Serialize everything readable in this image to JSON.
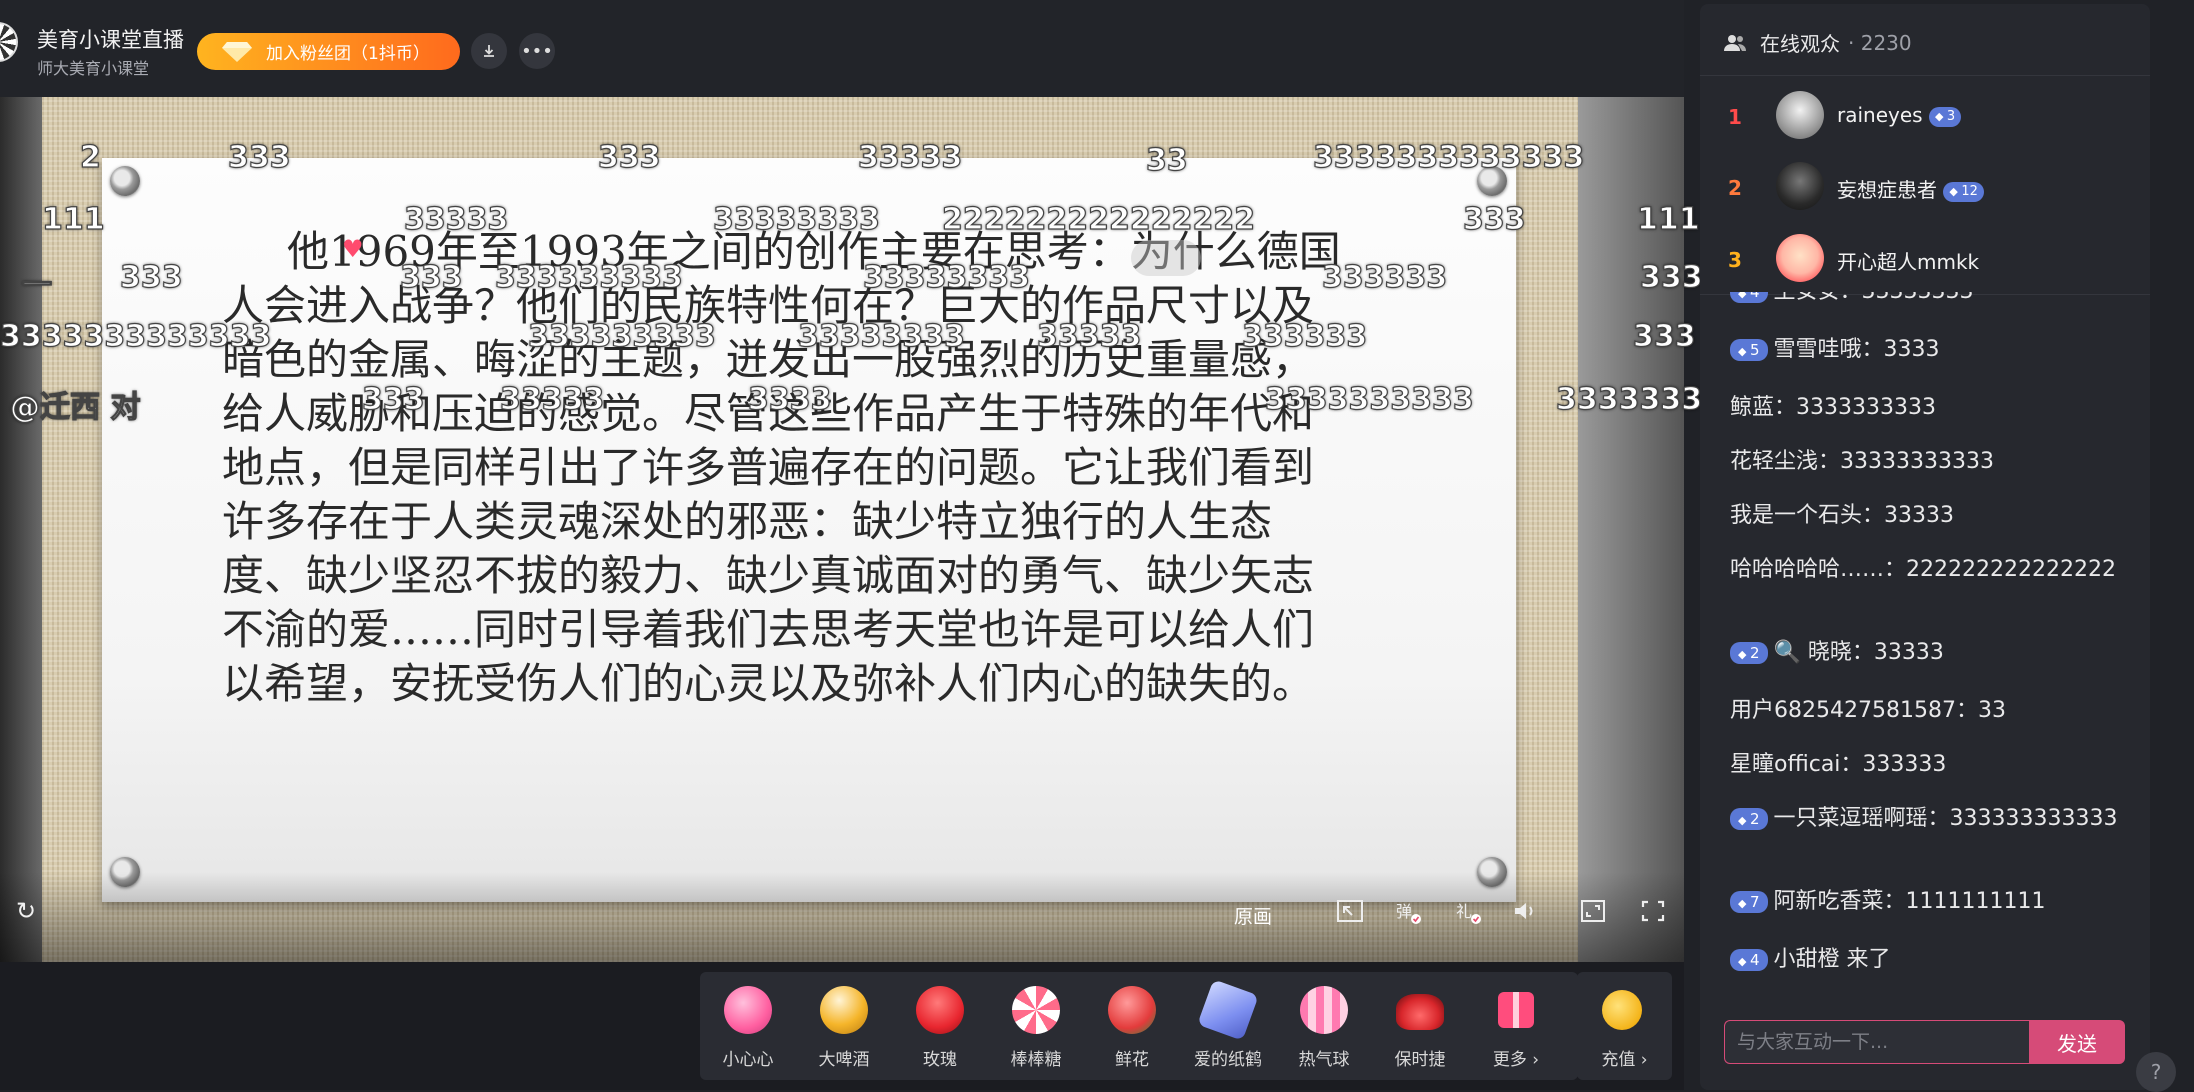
{
  "header": {
    "room_title": "美育小课堂直播",
    "room_subtitle": "师大美育小课堂",
    "fan_button": "加入粉丝团（1抖币）"
  },
  "slide": {
    "text": "他1969年至1993年之间的创作主要在思考：为什么德国人会进入战争？他们的民族特性何在？巨大的作品尺寸以及暗色的金属、晦涩的主题，迸发出一股强烈的历史重量感，给人威胁和压迫的感觉。尽管这些作品产生于特殊的年代和地点，但是同样引出了许多普遍存在的问题。它让我们看到许多存在于人类灵魂深处的邪恶：缺少特立独行的人生态度、缺少坚忍不拔的毅力、缺少真诚面对的勇气、缺少矢志不渝的爱……同时引导着我们去思考天堂也许是可以给人们以希望，安抚受伤人们的心灵以及弥补人们内心的缺失的。"
  },
  "danmaku": [
    "2",
    "333",
    "333",
    "33333",
    "33",
    "3333333333333",
    "111",
    "33333",
    "33333333",
    "222222222222222",
    "333",
    "111",
    "一",
    "333",
    "333",
    "333333333",
    "33333333",
    "333333",
    "333",
    "3333333333333",
    "333333333",
    "33333333",
    "33333",
    "333333",
    "333",
    "@迁西 对",
    "333",
    "33333",
    "3333",
    "3333333333",
    "3333333"
  ],
  "player": {
    "quality": "原画"
  },
  "gifts": [
    {
      "label": "小心心",
      "color": "#ff6fa5"
    },
    {
      "label": "大啤酒",
      "color": "#f5b52a"
    },
    {
      "label": "玫瑰",
      "color": "#e8262f"
    },
    {
      "label": "棒棒糖",
      "color": "#ff6b8a"
    },
    {
      "label": "鲜花",
      "color": "#e33b3b"
    },
    {
      "label": "爱的纸鹤",
      "color": "#7d8ff0"
    },
    {
      "label": "热气球",
      "color": "#ff7ab0"
    },
    {
      "label": "保时捷",
      "color": "#d8262b"
    },
    {
      "label": "更多 ›",
      "color": "#ff4d7d"
    }
  ],
  "recharge": {
    "label": "充值 ›"
  },
  "audience": {
    "title": "在线观众",
    "count": "· 2230",
    "ranks": [
      {
        "rank": "1",
        "name": "raineyes",
        "level": "3",
        "color": "#ff4b4b"
      },
      {
        "rank": "2",
        "name": "妄想症患者",
        "level": "12",
        "color": "#ff7a3d"
      },
      {
        "rank": "3",
        "name": "开心超人mmkk",
        "level": "",
        "color": "#ffb21d"
      }
    ]
  },
  "chat": [
    {
      "level": "4",
      "text": "王安安：33333333"
    },
    {
      "level": "5",
      "text": "雪雪哇哦：3333"
    },
    {
      "level": "",
      "text": "鲸蓝：3333333333"
    },
    {
      "level": "",
      "text": "花轻尘浅：33333333333"
    },
    {
      "level": "",
      "text": "我是一个石头：33333"
    },
    {
      "level": "",
      "text": "哈哈哈哈哈……：222222222222222"
    },
    {
      "level": "2",
      "text": "🔍 晓晓：33333"
    },
    {
      "level": "",
      "text": "用户6825427581587：33"
    },
    {
      "level": "",
      "text": "星瞳officai：333333"
    },
    {
      "level": "2",
      "text": "一只菜逗瑶啊瑶：333333333333"
    },
    {
      "level": "7",
      "text": "阿新吃香菜：1111111111"
    },
    {
      "level": "4",
      "text": "小甜橙 来了"
    }
  ],
  "chat_input": {
    "placeholder": "与大家互动一下...",
    "send_label": "发送"
  }
}
